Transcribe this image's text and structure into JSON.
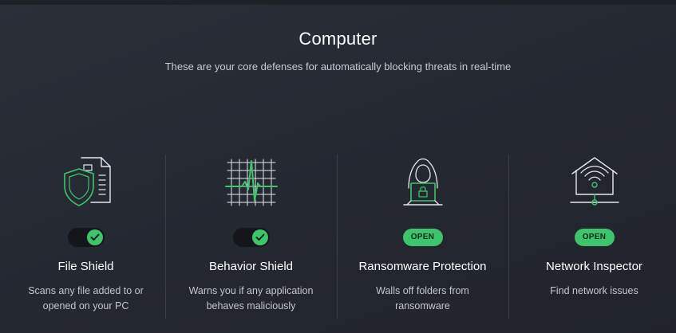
{
  "header": {
    "title": "Computer",
    "subtitle": "These are your core defenses for automatically blocking threats in real-time"
  },
  "colors": {
    "accent": "#3ec46d",
    "background": "#262a33",
    "toggle_track": "#14161b"
  },
  "cards": [
    {
      "name": "File Shield",
      "description": "Scans any file added to or opened on your PC",
      "icon": "file-shield-icon",
      "control": "toggle",
      "enabled": true
    },
    {
      "name": "Behavior Shield",
      "description": "Warns you if any application behaves maliciously",
      "icon": "heartbeat-grid-icon",
      "control": "toggle",
      "enabled": true
    },
    {
      "name": "Ransomware Protection",
      "description": "Walls off folders from ransomware",
      "icon": "hooded-hacker-laptop-icon",
      "control": "button",
      "button_label": "OPEN"
    },
    {
      "name": "Network Inspector",
      "description": "Find network issues",
      "icon": "wifi-house-icon",
      "control": "button",
      "button_label": "OPEN"
    }
  ]
}
